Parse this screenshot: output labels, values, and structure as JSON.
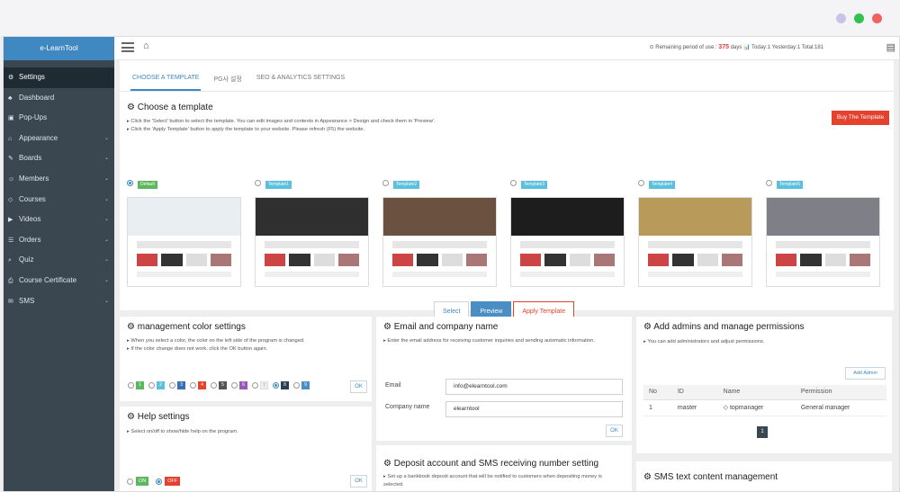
{
  "window": {
    "dots": [
      "#c9c3e8",
      "#31c24f",
      "#f26060"
    ]
  },
  "app": {
    "brand": "e-LearnTool"
  },
  "sidebar": {
    "items": [
      {
        "label": "Settings",
        "icon": "gears-icon",
        "glyph": "⚙",
        "active": true,
        "chevron": false
      },
      {
        "label": "Dashboard",
        "icon": "sitemap-icon",
        "glyph": "♣",
        "active": false,
        "chevron": false
      },
      {
        "label": "Pop-Ups",
        "icon": "image-icon",
        "glyph": "▣",
        "active": false,
        "chevron": false
      },
      {
        "label": "Appearance",
        "icon": "home-icon",
        "glyph": "⌂",
        "active": false,
        "chevron": true
      },
      {
        "label": "Boards",
        "icon": "pencil-icon",
        "glyph": "✎",
        "active": false,
        "chevron": true
      },
      {
        "label": "Members",
        "icon": "users-icon",
        "glyph": "☺",
        "active": false,
        "chevron": true
      },
      {
        "label": "Courses",
        "icon": "graduation-cap-icon",
        "glyph": "◇",
        "active": false,
        "chevron": true
      },
      {
        "label": "Videos",
        "icon": "video-icon",
        "glyph": "▶",
        "active": false,
        "chevron": true
      },
      {
        "label": "Orders",
        "icon": "list-icon",
        "glyph": "☰",
        "active": false,
        "chevron": true
      },
      {
        "label": "Quiz",
        "icon": "search-icon",
        "glyph": "⌕",
        "active": false,
        "chevron": true
      },
      {
        "label": "Course Certificate",
        "icon": "print-icon",
        "glyph": "⎙",
        "active": false,
        "chevron": true
      },
      {
        "label": "SMS",
        "icon": "envelope-icon",
        "glyph": "✉",
        "active": false,
        "chevron": true
      }
    ]
  },
  "topbar": {
    "remaining_label": "⊙ Remaining period of use :",
    "remaining_days": "375",
    "days_label": "days",
    "stats": "📊 Today:1 Yesterday:1 Total:181"
  },
  "tabs": [
    {
      "label": "CHOOSE A TEMPLATE",
      "active": true
    },
    {
      "label": "PG사 설정",
      "active": false
    },
    {
      "label": "SEO & ANALYTICS SETTINGS",
      "active": false
    }
  ],
  "choose_template": {
    "title": "Choose a template",
    "desc1": "▸ Click the 'Select' button to select the template. You can edit images and contents in Appearance > Design and check them in 'Preview'.",
    "desc2": "▸ Click the 'Apply Template' button to apply the template to your website. Please refresh (F5) the website.",
    "buy_button": "Buy The Template",
    "templates": [
      {
        "label": "Default",
        "selected": true,
        "color": "#5cb85c",
        "hero": "#e9eef2"
      },
      {
        "label": "Template1",
        "selected": false,
        "color": "#5bc0de",
        "hero": "#2f2f2f"
      },
      {
        "label": "Template2",
        "selected": false,
        "color": "#5bc0de",
        "hero": "#6b5140"
      },
      {
        "label": "Template3",
        "selected": false,
        "color": "#5bc0de",
        "hero": "#1d1d1d"
      },
      {
        "label": "Template4",
        "selected": false,
        "color": "#5bc0de",
        "hero": "#b89a5a"
      },
      {
        "label": "Template5",
        "selected": false,
        "color": "#5bc0de",
        "hero": "#7f7f87"
      }
    ],
    "buttons": {
      "select": "Select",
      "preview": "Preview",
      "apply": "Apply Template"
    }
  },
  "color_settings": {
    "title": "management color settings",
    "desc1": "▸ When you select a color, the color on the left side of the program is changed.",
    "desc2": "▸ If the color change does not work, click the OK button again.",
    "swatches": [
      {
        "num": "1",
        "color": "#5cb85c",
        "selected": false
      },
      {
        "num": "2",
        "color": "#5bc0de",
        "selected": false
      },
      {
        "num": "3",
        "color": "#3a6fb5",
        "selected": false
      },
      {
        "num": "4",
        "color": "#e5412f",
        "selected": false
      },
      {
        "num": "5",
        "color": "#555555",
        "selected": false
      },
      {
        "num": "6",
        "color": "#9b59b6",
        "selected": false
      },
      {
        "num": "7",
        "color": "#eeeeee",
        "selected": false
      },
      {
        "num": "8",
        "color": "#2c3e50",
        "selected": true
      },
      {
        "num": "9",
        "color": "#4a8ec4",
        "selected": false
      }
    ],
    "ok": "OK"
  },
  "help_settings": {
    "title": "Help settings",
    "desc": "▸ Select on/off to show/hide help on the program.",
    "on": "ON",
    "off": "OFF",
    "ok": "OK"
  },
  "email_company": {
    "title": "Email and company name",
    "desc": "▸ Enter the email address for receiving customer inquiries and sending automatic information.",
    "email_label": "Email",
    "email_value": "info@elearntool.com",
    "company_label": "Company name",
    "company_value": "elearntool",
    "ok": "OK"
  },
  "deposit": {
    "title": "Deposit account and SMS receiving number setting",
    "desc": "▸ Set up a bankbook deposit account that will be notified to customers when depositing money is selected."
  },
  "admins": {
    "title": "Add admins and manage permissions",
    "desc": "▸ You can add administrators and adjust permissions.",
    "add_button": "Add Admin",
    "columns": [
      "No",
      "ID",
      "Name",
      "Permission"
    ],
    "rows": [
      [
        "1",
        "master",
        "◇ topmanager",
        "General manager"
      ]
    ],
    "page": "1"
  },
  "sms": {
    "title": "SMS text content management"
  }
}
